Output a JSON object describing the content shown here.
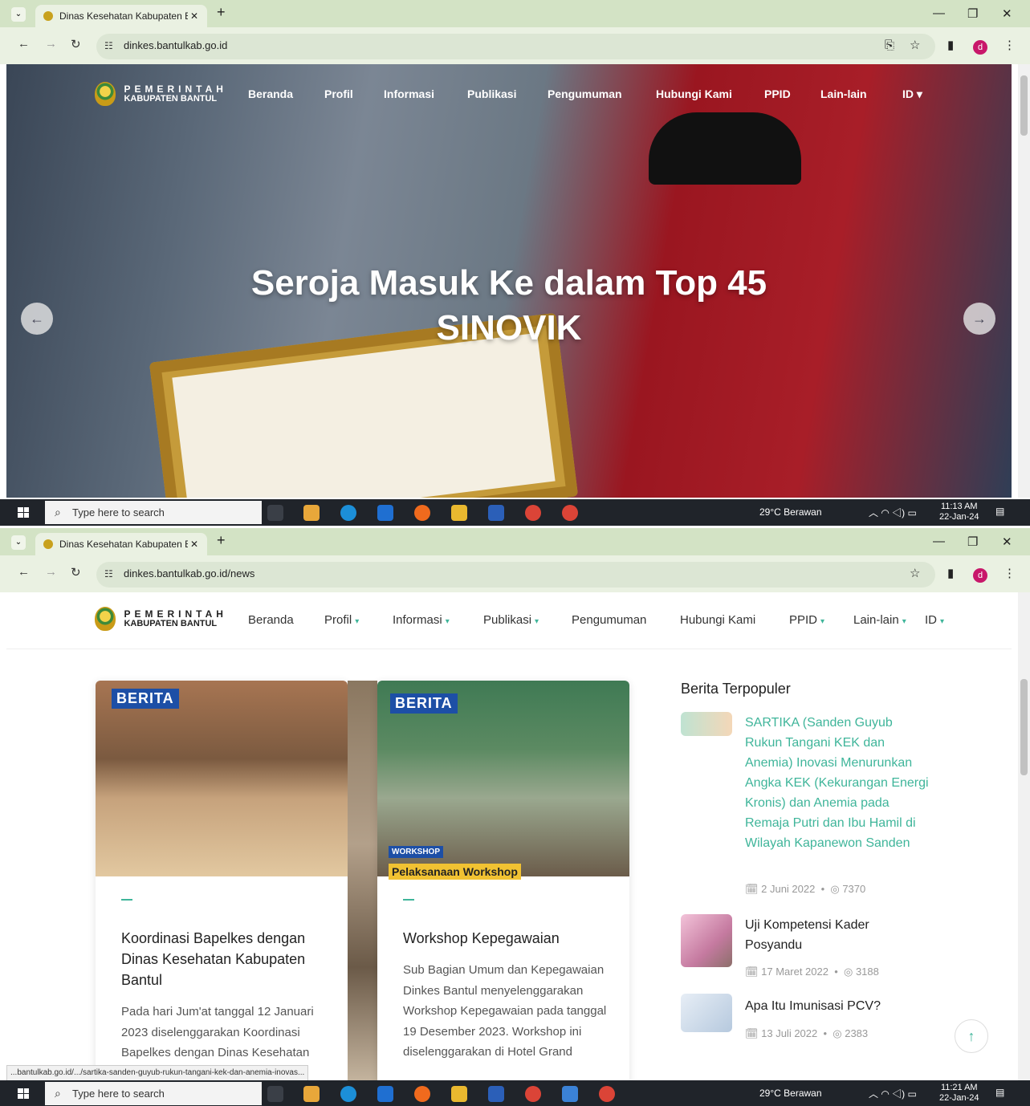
{
  "windows": [
    {
      "tab_title": "Dinas Kesehatan Kabupaten Ba",
      "url": "dinkes.bantulkab.go.id",
      "logo_line1": "PEMERINTAH",
      "logo_line2": "KABUPATEN BANTUL",
      "nav": [
        "Beranda",
        "Profil",
        "Informasi",
        "Publikasi",
        "Pengumuman",
        "Hubungi Kami",
        "PPID",
        "Lain-lain",
        "ID ▾"
      ],
      "headline_line1": "Seroja Masuk Ke dalam Top 45",
      "headline_line2": "SINOVIK",
      "taskbar": {
        "search": "Type here to search",
        "weather": "29°C  Berawan",
        "time": "11:13 AM",
        "date": "22-Jan-24"
      }
    },
    {
      "tab_title": "Dinas Kesehatan Kabupaten Ba",
      "url": "dinkes.bantulkab.go.id/news",
      "logo_line1": "PEMERINTAH",
      "logo_line2": "KABUPATEN BANTUL",
      "nav": [
        "Beranda",
        "Profil",
        "Informasi",
        "Publikasi",
        "Pengumuman",
        "Hubungi Kami",
        "PPID",
        "Lain-lain",
        "ID"
      ],
      "cards": [
        {
          "badge": "BERITA",
          "title": "Koordinasi Bapelkes dengan Dinas Kesehatan Kabupaten Bantul",
          "desc": "Pada hari Jum'at tanggal 12 Januari 2023 diselenggarakan Koordinasi Bapelkes dengan Dinas Kesehatan"
        },
        {
          "badge": "BERITA",
          "title": "Workshop Kepegawaian",
          "desc": "Sub Bagian Umum dan Kepegawaian Dinkes Bantul menyelenggarakan Workshop Kepegawaian pada tanggal 19 Desember 2023. Workshop ini diselenggarakan di Hotel Grand",
          "img_tag": "WORKSHOP",
          "img_caption": "Pelaksanaan Workshop"
        }
      ],
      "sidebar_heading": "Berita Terpopuler",
      "popular": [
        {
          "title": "SARTIKA (Sanden Guyub Rukun Tangani KEK dan Anemia) Inovasi Menurunkan Angka KEK (Kekurangan Energi Kronis) dan Anemia pada Remaja Putri dan Ibu Hamil di Wilayah Kapanewon Sanden",
          "date": "2 Juni 2022",
          "views": "7370"
        },
        {
          "title": "Uji Kompetensi Kader Posyandu",
          "date": "17 Maret 2022",
          "views": "3188"
        },
        {
          "title": "Apa Itu Imunisasi PCV?",
          "date": "13 Juli 2022",
          "views": "2383"
        }
      ],
      "status_url": "...bantulkab.go.id/.../sartika-sanden-guyub-rukun-tangani-kek-dan-anemia-inovas...",
      "taskbar": {
        "search": "Type here to search",
        "weather": "29°C  Berawan",
        "time": "11:21 AM",
        "date": "22-Jan-24"
      }
    }
  ],
  "colors": {
    "accent": "#3fb59a",
    "sartika_link": "#3fb59a",
    "badge": "#1d4fa6",
    "taskbar": "#20242a",
    "chrome_green": "#d3e3c5"
  }
}
